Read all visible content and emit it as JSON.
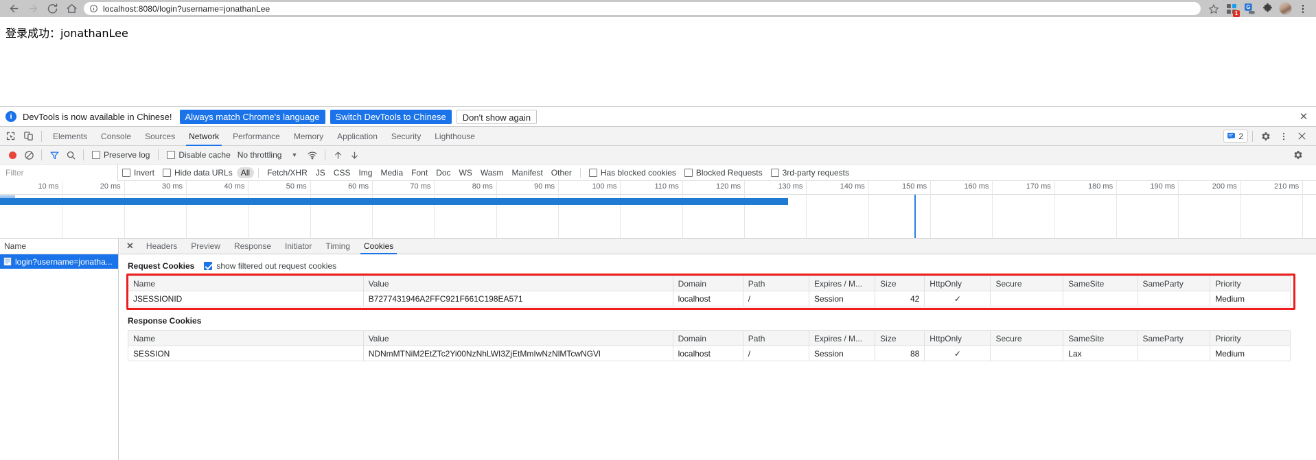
{
  "browser": {
    "back_icon": "back-arrow-icon",
    "forward_icon": "forward-arrow-icon",
    "reload_icon": "reload-icon",
    "home_icon": "home-icon",
    "url": "localhost:8080/login?username=jonathanLee",
    "url_host": "localhost:8080",
    "url_path": "/login?username=jonathanLee",
    "bookmark_icon": "star-icon",
    "extension_badge": "1",
    "translate_icon": "google-translate-icon",
    "puzzle_icon": "extensions-puzzle-icon",
    "avatar_icon": "profile-avatar",
    "menu_icon": "three-dot-menu-icon"
  },
  "page": {
    "body_text": "登录成功：jonathanLee"
  },
  "infobar": {
    "icon": "info-icon",
    "icon_glyph": "i",
    "message": "DevTools is now available in Chinese!",
    "btn_always": "Always match Chrome's language",
    "btn_switch": "Switch DevTools to Chinese",
    "btn_dismiss": "Don't show again",
    "close_glyph": "✕",
    "accent": "#1a73e8"
  },
  "devtools": {
    "inspect_icon": "inspect-element-icon",
    "device_icon": "toggle-device-toolbar-icon",
    "tabs": [
      {
        "label": "Elements",
        "active": false
      },
      {
        "label": "Console",
        "active": false
      },
      {
        "label": "Sources",
        "active": false
      },
      {
        "label": "Network",
        "active": true
      },
      {
        "label": "Performance",
        "active": false
      },
      {
        "label": "Memory",
        "active": false
      },
      {
        "label": "Application",
        "active": false
      },
      {
        "label": "Security",
        "active": false
      },
      {
        "label": "Lighthouse",
        "active": false
      }
    ],
    "message_count": "2",
    "message_icon": "console-message-icon",
    "settings_icon": "gear-icon",
    "more_icon": "three-dot-menu-icon",
    "close_icon": "close-icon"
  },
  "network_toolbar": {
    "record_icon": "record-button",
    "clear_icon": "clear-icon",
    "filter_icon": "filter-funnel-icon",
    "search_icon": "search-icon",
    "preserve_log": {
      "label": "Preserve log",
      "checked": false
    },
    "disable_cache": {
      "label": "Disable cache",
      "checked": false
    },
    "throttling": "No throttling",
    "throttle_caret": "▼",
    "wifi_icon": "network-conditions-icon",
    "import_icon": "import-har-icon",
    "export_icon": "export-har-icon",
    "settings_icon": "network-settings-gear-icon"
  },
  "filter_row": {
    "placeholder": "Filter",
    "value": "",
    "invert": {
      "label": "Invert",
      "checked": false
    },
    "hide_data_urls": {
      "label": "Hide data URLs",
      "checked": false
    },
    "types": [
      {
        "label": "All",
        "active": true
      },
      {
        "label": "Fetch/XHR",
        "active": false
      },
      {
        "label": "JS",
        "active": false
      },
      {
        "label": "CSS",
        "active": false
      },
      {
        "label": "Img",
        "active": false
      },
      {
        "label": "Media",
        "active": false
      },
      {
        "label": "Font",
        "active": false
      },
      {
        "label": "Doc",
        "active": false
      },
      {
        "label": "WS",
        "active": false
      },
      {
        "label": "Wasm",
        "active": false
      },
      {
        "label": "Manifest",
        "active": false
      },
      {
        "label": "Other",
        "active": false
      }
    ],
    "has_blocked_cookies": {
      "label": "Has blocked cookies",
      "checked": false
    },
    "blocked_requests": {
      "label": "Blocked Requests",
      "checked": false
    },
    "third_party": {
      "label": "3rd-party requests",
      "checked": false
    }
  },
  "overview": {
    "ticks": [
      "10 ms",
      "20 ms",
      "30 ms",
      "40 ms",
      "50 ms",
      "60 ms",
      "70 ms",
      "80 ms",
      "90 ms",
      "100 ms",
      "110 ms",
      "120 ms",
      "130 ms",
      "140 ms",
      "150 ms",
      "160 ms",
      "170 ms",
      "180 ms",
      "190 ms",
      "200 ms",
      "210 ms"
    ],
    "bar_color": "#1f7ad4",
    "playhead_color": "#2a7fe0"
  },
  "request_list": {
    "column_header": "Name",
    "rows": [
      {
        "name": "login?username=jonatha...",
        "icon": "document-icon",
        "selected": true
      }
    ]
  },
  "detail_panel": {
    "close_glyph": "✕",
    "tabs": [
      {
        "label": "Headers",
        "active": false
      },
      {
        "label": "Preview",
        "active": false
      },
      {
        "label": "Response",
        "active": false
      },
      {
        "label": "Initiator",
        "active": false
      },
      {
        "label": "Timing",
        "active": false
      },
      {
        "label": "Cookies",
        "active": true
      }
    ]
  },
  "cookies": {
    "request_section_title": "Request Cookies",
    "show_filtered_label": "show filtered out request cookies",
    "show_filtered_checked": true,
    "response_section_title": "Response Cookies",
    "columns": [
      "Name",
      "Value",
      "Domain",
      "Path",
      "Expires / M...",
      "Size",
      "HttpOnly",
      "Secure",
      "SameSite",
      "SameParty",
      "Priority"
    ],
    "request_rows": [
      {
        "name": "JSESSIONID",
        "value": "B7277431946A2FFC921F661C198EA571",
        "domain": "localhost",
        "path": "/",
        "expires": "Session",
        "size": "42",
        "httponly": "✓",
        "secure": "",
        "samesite": "",
        "sameparty": "",
        "priority": "Medium"
      }
    ],
    "response_rows": [
      {
        "name": "SESSION",
        "value": "NDNmMTNiM2EtZTc2Yi00NzNhLWI3ZjEtMmIwNzNlMTcwNGVl",
        "domain": "localhost",
        "path": "/",
        "expires": "Session",
        "size": "88",
        "httponly": "✓",
        "secure": "",
        "samesite": "Lax",
        "sameparty": "",
        "priority": "Medium"
      }
    ],
    "highlight_color": "#ee1c1c"
  }
}
